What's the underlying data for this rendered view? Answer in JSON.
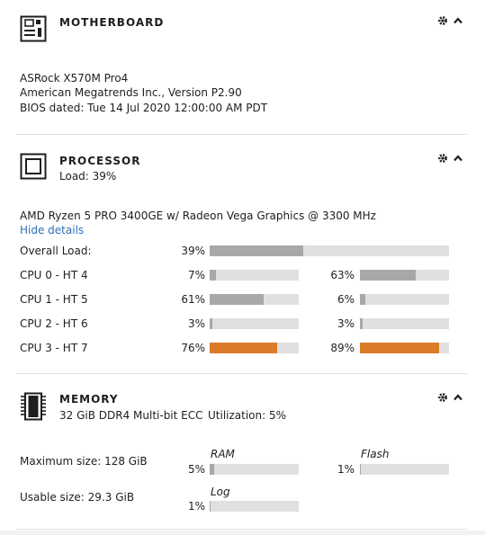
{
  "motherboard": {
    "title": "MOTHERBOARD",
    "lines": [
      "ASRock X570M Pro4",
      "American Megatrends Inc., Version P2.90",
      "BIOS dated: Tue 14 Jul 2020 12:00:00 AM PDT"
    ]
  },
  "processor": {
    "title": "PROCESSOR",
    "load_text": "Load: 39%",
    "model": "AMD Ryzen 5 PRO 3400GE w/ Radeon Vega Graphics @ 3300 MHz",
    "toggle_details": "Hide details",
    "overall": {
      "label": "Overall Load:",
      "pct_text": "39%",
      "value": 0.39
    },
    "cores": [
      {
        "label": "CPU 0 - HT 4",
        "a_text": "7%",
        "a": 0.07,
        "b_text": "63%",
        "b": 0.63,
        "a_hi": false,
        "b_hi": false
      },
      {
        "label": "CPU 1 - HT 5",
        "a_text": "61%",
        "a": 0.61,
        "b_text": "6%",
        "b": 0.06,
        "a_hi": false,
        "b_hi": false
      },
      {
        "label": "CPU 2 - HT 6",
        "a_text": "3%",
        "a": 0.03,
        "b_text": "3%",
        "b": 0.03,
        "a_hi": false,
        "b_hi": false
      },
      {
        "label": "CPU 3 - HT 7",
        "a_text": "76%",
        "a": 0.76,
        "b_text": "89%",
        "b": 0.89,
        "a_hi": true,
        "b_hi": true
      }
    ]
  },
  "memory": {
    "title": "MEMORY",
    "summary": "32 GiB DDR4 Multi-bit ECC",
    "utilization": "Utilization: 5%",
    "max_size": "Maximum size: 128 GiB",
    "usable_size": "Usable size: 29.3 GiB",
    "ram": {
      "label": "RAM",
      "pct_text": "5%",
      "value": 0.05
    },
    "flash": {
      "label": "Flash",
      "pct_text": "1%",
      "value": 0.01
    },
    "log": {
      "label": "Log",
      "pct_text": "1%",
      "value": 0.01
    }
  },
  "colors": {
    "bar_fill": "#a8a8a8",
    "bar_hot": "#db7b28",
    "bar_track": "#e0e0e0"
  }
}
